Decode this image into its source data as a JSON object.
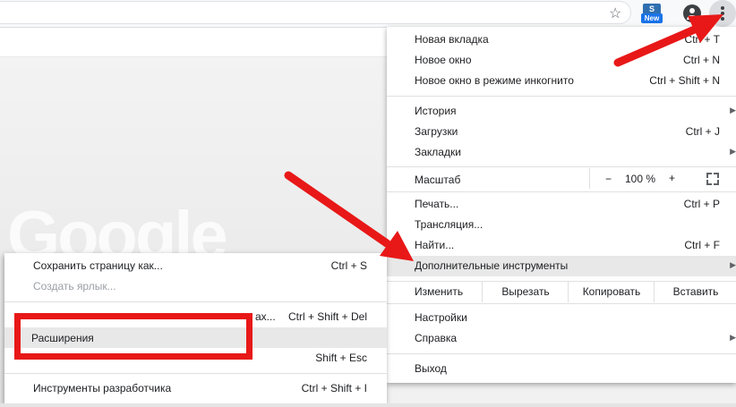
{
  "toolbar": {
    "star_icon": "star-icon",
    "extension": {
      "badge_top": "S",
      "badge_label": "New"
    },
    "account_icon": "account-icon",
    "menu_icon": "kebab-menu-icon"
  },
  "page": {
    "logo_text": "Google"
  },
  "menu": {
    "new_tab": {
      "label": "Новая вкладка",
      "shortcut": "Ctrl + T"
    },
    "new_window": {
      "label": "Новое окно",
      "shortcut": "Ctrl + N"
    },
    "incognito": {
      "label": "Новое окно в режиме инкогнито",
      "shortcut": "Ctrl + Shift + N"
    },
    "history": {
      "label": "История"
    },
    "downloads": {
      "label": "Загрузки",
      "shortcut": "Ctrl + J"
    },
    "bookmarks": {
      "label": "Закладки"
    },
    "zoom": {
      "label": "Масштаб",
      "minus": "−",
      "value": "100 %",
      "plus": "+"
    },
    "print": {
      "label": "Печать...",
      "shortcut": "Ctrl + P"
    },
    "cast": {
      "label": "Трансляция..."
    },
    "find": {
      "label": "Найти...",
      "shortcut": "Ctrl + F"
    },
    "more_tools": {
      "label": "Дополнительные инструменты"
    },
    "edit": {
      "label": "Изменить",
      "cut": "Вырезать",
      "copy": "Копировать",
      "paste": "Вставить"
    },
    "settings": {
      "label": "Настройки"
    },
    "help": {
      "label": "Справка"
    },
    "exit": {
      "label": "Выход"
    }
  },
  "submenu": {
    "save_page": {
      "label": "Сохранить страницу как...",
      "shortcut": "Ctrl + S"
    },
    "create_shortcut": {
      "label": "Создать ярлык..."
    },
    "clear_data": {
      "label_tail": "ах...",
      "shortcut": "Ctrl + Shift + Del"
    },
    "extensions": {
      "label": "Расширения"
    },
    "task_manager": {
      "shortcut": "Shift + Esc"
    },
    "dev_tools": {
      "label": "Инструменты разработчика",
      "shortcut": "Ctrl + Shift + I"
    }
  },
  "colors": {
    "highlight_red": "#e81818",
    "menu_hover": "#e8e8e8"
  }
}
